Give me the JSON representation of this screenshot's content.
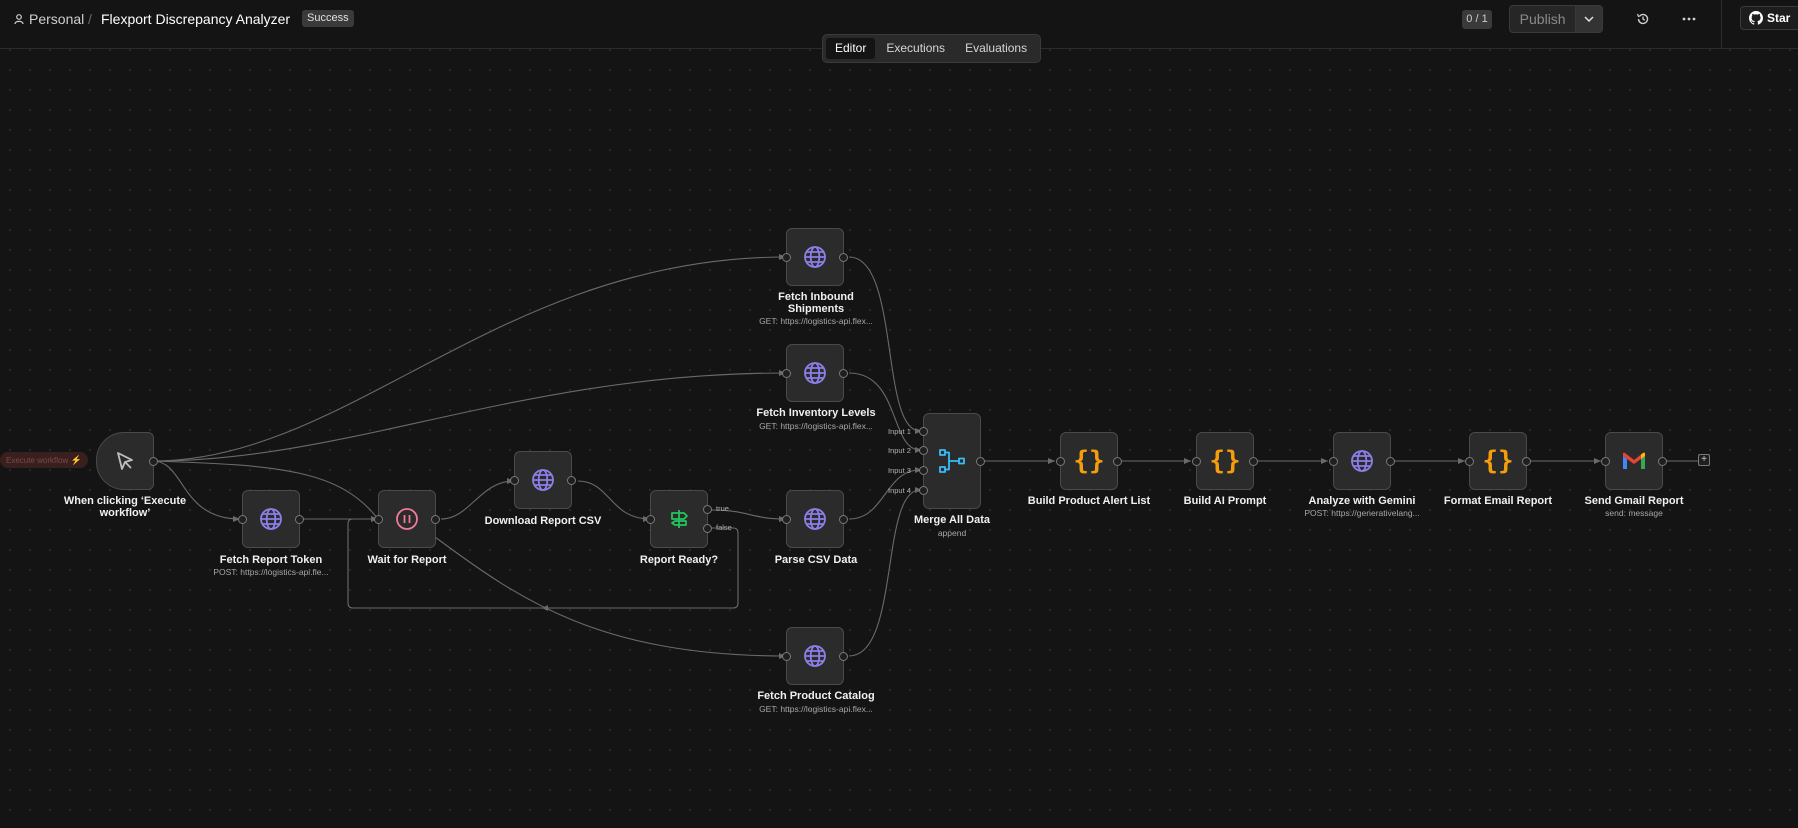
{
  "header": {
    "project": "Personal",
    "separator": "/",
    "workflow_title": "Flexport Discrepancy Analyzer",
    "status_badge": "Success",
    "counter": "0 / 1",
    "publish_label": "Publish",
    "star_label": "Star"
  },
  "tabs": [
    {
      "label": "Editor",
      "active": true
    },
    {
      "label": "Executions",
      "active": false
    },
    {
      "label": "Evaluations",
      "active": false
    }
  ],
  "trigger_pill": "Execute workflow",
  "nodes": {
    "trigger": {
      "label": "When clicking ‘Execute workflow’",
      "icon": "cursor-icon"
    },
    "fetch_token": {
      "label": "Fetch Report Token",
      "sub": "POST: https://logistics-api.fle...",
      "icon": "globe-icon"
    },
    "wait": {
      "label": "Wait for Report",
      "icon": "pause-icon"
    },
    "download_csv": {
      "label": "Download Report CSV",
      "icon": "globe-icon"
    },
    "report_ready": {
      "label": "Report Ready?",
      "icon": "signpost-icon",
      "true_label": "true",
      "false_label": "false"
    },
    "fetch_inbound": {
      "label": "Fetch Inbound Shipments",
      "sub": "GET: https://logistics-api.flex...",
      "icon": "globe-icon"
    },
    "fetch_inventory": {
      "label": "Fetch Inventory Levels",
      "sub": "GET: https://logistics-api.flex...",
      "icon": "globe-icon"
    },
    "parse_csv": {
      "label": "Parse CSV Data",
      "icon": "globe-icon"
    },
    "fetch_catalog": {
      "label": "Fetch Product Catalog",
      "sub": "GET: https://logistics-api.flex...",
      "icon": "globe-icon"
    },
    "merge": {
      "label": "Merge All Data",
      "sub": "append",
      "icon": "merge-icon",
      "inputs": [
        "Input 1",
        "Input 2",
        "Input 3",
        "Input 4"
      ]
    },
    "build_alert": {
      "label": "Build Product Alert List",
      "icon": "code-braces-icon",
      "glyph": "{}"
    },
    "build_prompt": {
      "label": "Build AI Prompt",
      "icon": "code-braces-icon",
      "glyph": "{}"
    },
    "gemini": {
      "label": "Analyze with Gemini",
      "sub": "POST: https://generativelang...",
      "icon": "globe-icon"
    },
    "format_email": {
      "label": "Format Email Report",
      "icon": "code-braces-icon",
      "glyph": "{}"
    },
    "gmail": {
      "label": "Send Gmail Report",
      "sub": "send: message",
      "icon": "gmail-icon"
    }
  },
  "colors": {
    "canvas": "#141414",
    "node_bg": "#2b2b2b",
    "http_icon": "#8b7fe8",
    "code_icon": "#f59e0b",
    "wait_icon": "#f07a9a",
    "if_icon": "#22c55e",
    "merge_icon": "#38bdf8"
  }
}
